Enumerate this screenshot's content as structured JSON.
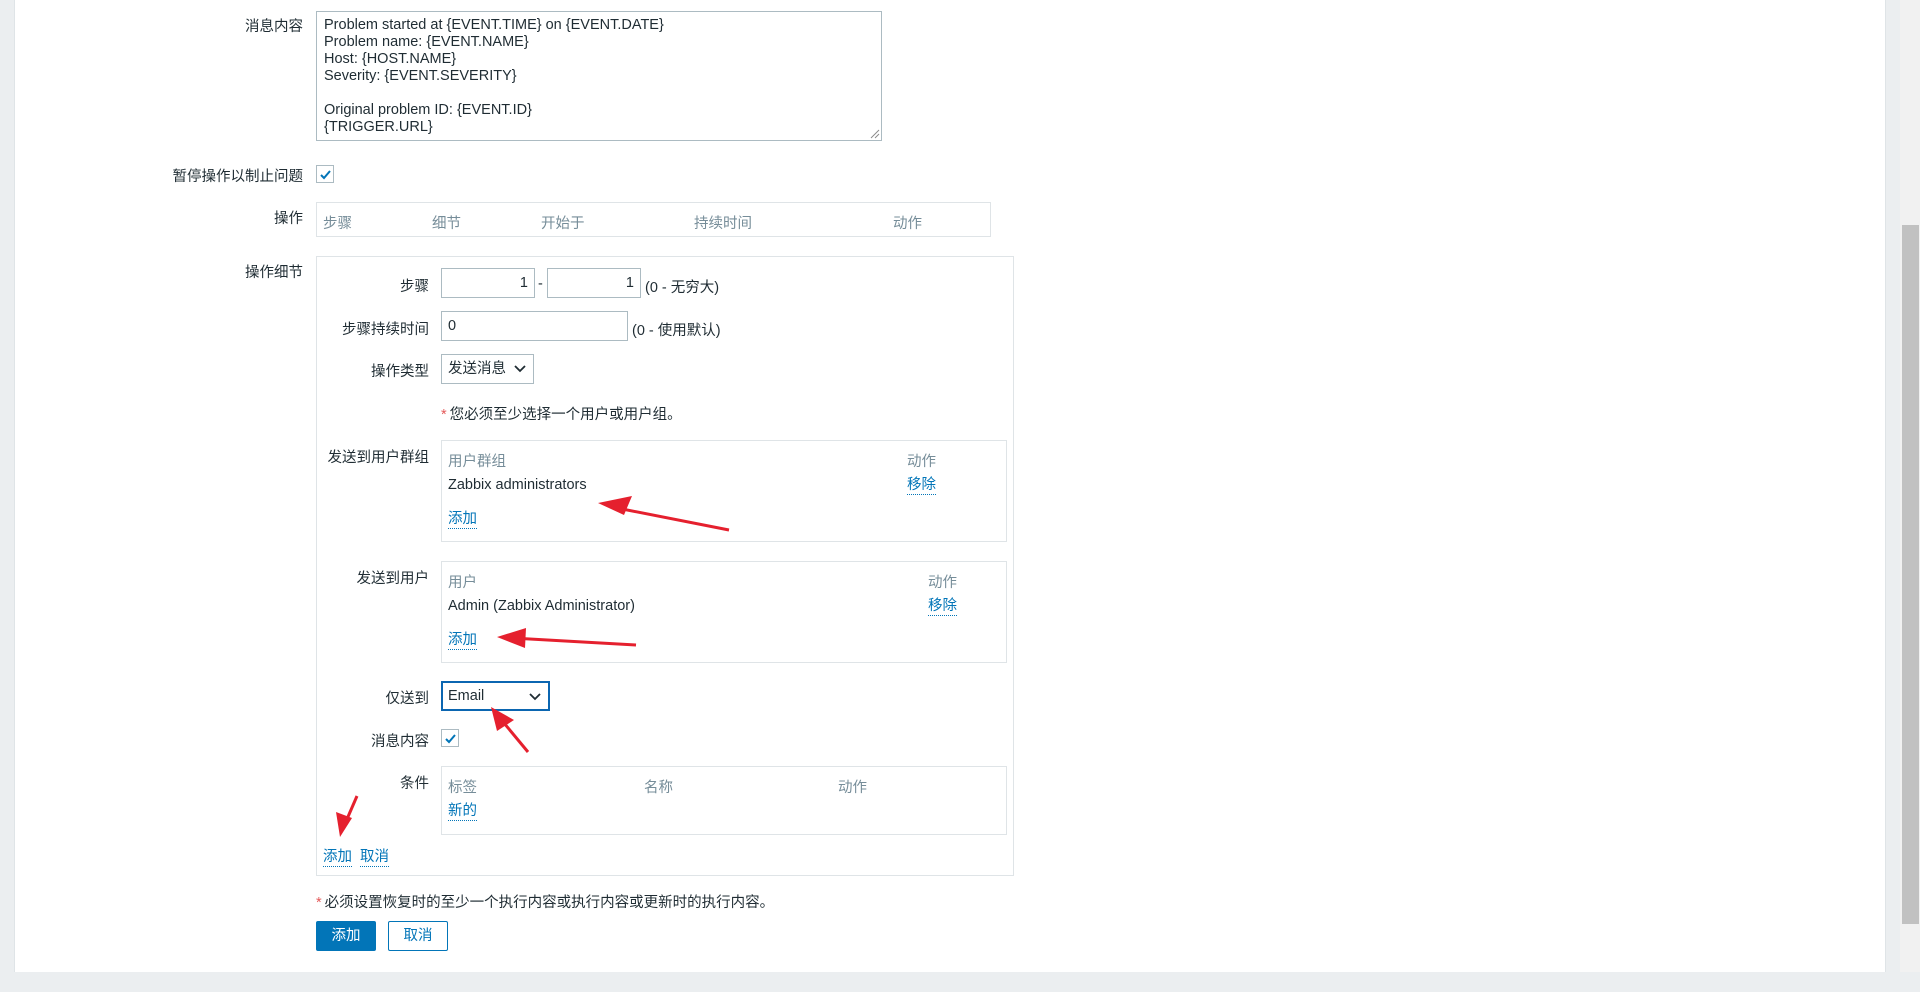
{
  "form": {
    "message_label": "消息内容",
    "message_text": "Problem started at {EVENT.TIME} on {EVENT.DATE}\nProblem name: {EVENT.NAME}\nHost: {HOST.NAME}\nSeverity: {EVENT.SEVERITY}\n\nOriginal problem ID: {EVENT.ID}\n{TRIGGER.URL}",
    "pause_label": "暂停操作以制止问题",
    "operations_label": "操作",
    "operations_headers": [
      "步骤",
      "细节",
      "开始于",
      "持续时间",
      "动作"
    ],
    "op_details_label": "操作细节"
  },
  "details": {
    "steps_label": "步骤",
    "step_from": "1",
    "step_to": "1",
    "step_dash": "-",
    "steps_hint": "(0 - 无穷大)",
    "duration_label": "步骤持续时间",
    "duration_value": "0",
    "duration_hint": "(0 - 使用默认)",
    "optype_label": "操作类型",
    "optype_value": "发送消息",
    "required_note": "您必须至少选择一个用户或用户组。",
    "required_star": "*",
    "groups_label": "发送到用户群组",
    "groups_headers": [
      "用户群组",
      "动作"
    ],
    "group_row": {
      "name": "Zabbix administrators",
      "action": "移除"
    },
    "groups_add": "添加",
    "users_label": "发送到用户",
    "users_headers": [
      "用户",
      "动作"
    ],
    "user_row": {
      "name": "Admin (Zabbix Administrator)",
      "action": "移除"
    },
    "users_add": "添加",
    "sendonly_label": "仅送到",
    "sendonly_value": "Email",
    "msgcontent_label": "消息内容",
    "conditions_label": "条件",
    "conditions_headers": [
      "标签",
      "名称",
      "动作"
    ],
    "conditions_new": "新的",
    "add_link": "添加",
    "cancel_link": "取消"
  },
  "footer": {
    "note": "必须设置恢复时的至少一个执行内容或执行内容或更新时的执行内容。",
    "note_star": "*",
    "add_button": "添加",
    "cancel_button": "取消"
  },
  "colors": {
    "accent": "#0275b8",
    "annotation_arrow": "#e5202e",
    "required_star": "#e45959"
  }
}
